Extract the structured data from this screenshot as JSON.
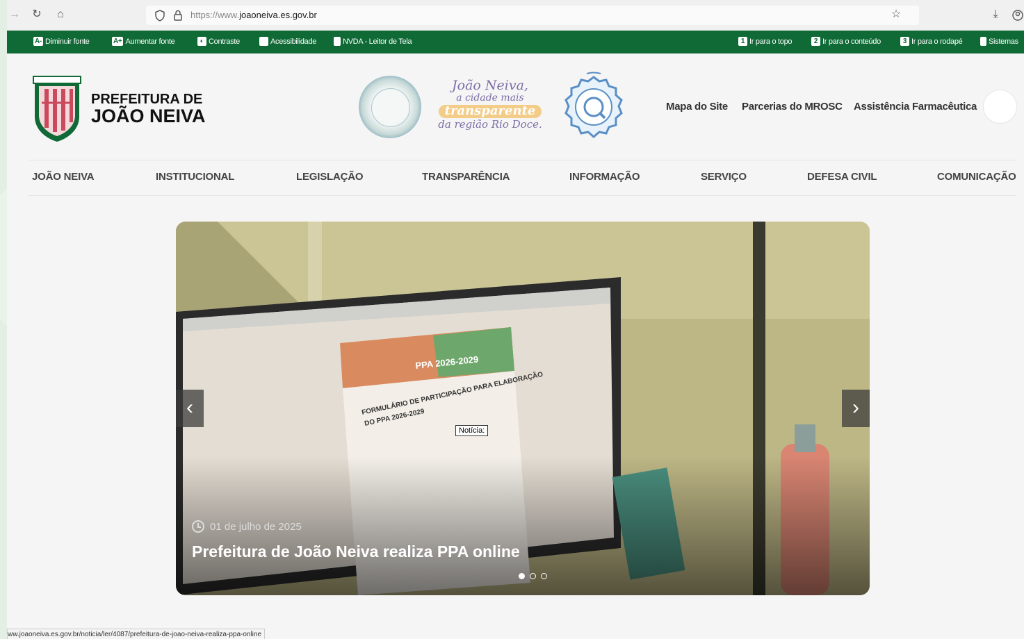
{
  "browser": {
    "url_prefix": "https://www.",
    "url_domain": "joaoneiva.es.gov.br",
    "status_url": "ww.joaoneiva.es.gov.br/noticia/ler/4087/prefeitura-de-joao-neiva-realiza-ppa-online"
  },
  "accessibility_bar": {
    "decrease_font_key": "A-",
    "decrease_font": "Diminuir fonte",
    "increase_font_key": "A+",
    "increase_font": "Aumentar fonte",
    "contrast_key": "◐",
    "contrast": "Contraste",
    "accessibility": "Acessibilidade",
    "nvda": "NVDA - Leitor de Tela",
    "goto_top_key": "1",
    "goto_top": "Ir para o topo",
    "goto_content_key": "2",
    "goto_content": "Ir para o conteúdo",
    "goto_footer_key": "3",
    "goto_footer": "Ir para o rodapé",
    "systems": "Sistemas"
  },
  "header": {
    "brand_line1": "PREFEITURA DE",
    "brand_line2": "JOÃO NEIVA",
    "tagline_l1": "João Neiva,",
    "tagline_l2": "a cidade mais",
    "tagline_l3": "transparente",
    "tagline_l4": "da região Rio Doce.",
    "top_links": [
      "Mapa do Site",
      "Parcerias do MROSC",
      "Assistência Farmacêutica"
    ]
  },
  "nav": {
    "items": [
      "JOÃO NEIVA",
      "INSTITUCIONAL",
      "LEGISLAÇÃO",
      "TRANSPARÊNCIA",
      "INFORMAÇÃO",
      "SERVIÇO",
      "DEFESA CIVIL",
      "COMUNICAÇÃO"
    ]
  },
  "slider": {
    "date": "01 de julho de 2025",
    "title": "Prefeitura de João Neiva realiza PPA online",
    "tooltip": "Notícia:",
    "screen_heading1": "PPA 2026-2029",
    "screen_heading2": "FORMULÁRIO DE PARTICIPAÇÃO PARA ELABORAÇÃO",
    "screen_heading3": "DO PPA 2026-2029",
    "prev": "‹",
    "next": "›",
    "slide_count": 3,
    "active_slide": 1
  },
  "colors": {
    "brand_green": "#0f6a36",
    "tagline_purple": "#7d6fa6",
    "tagline_highlight": "#f3cc88"
  }
}
